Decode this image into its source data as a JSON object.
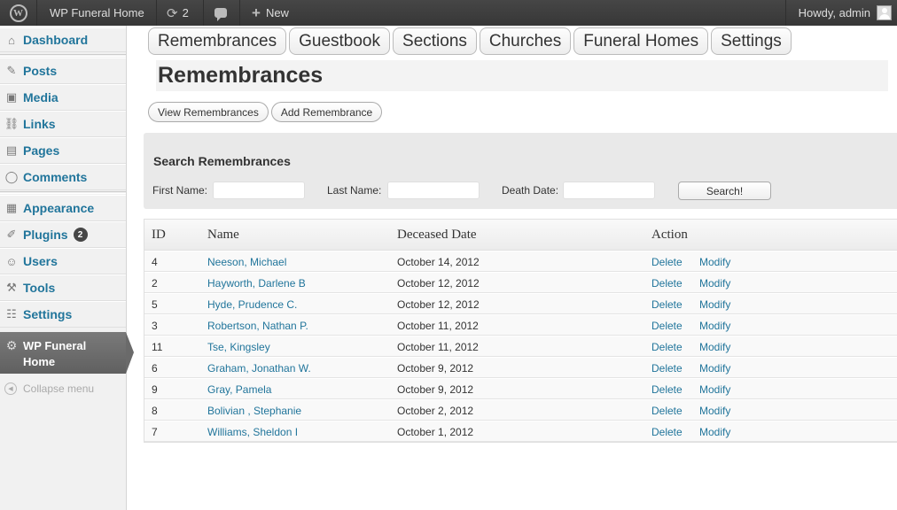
{
  "adminbar": {
    "logo": "W",
    "site_name": "WP Funeral Home",
    "updates_count": "2",
    "new_label": "New",
    "howdy": "Howdy, admin",
    "icons": [
      "wordpress-logo-icon",
      "updates-icon",
      "comments-icon",
      "plus-icon",
      "avatar-icon"
    ]
  },
  "sidebar": {
    "items": [
      {
        "label": "Dashboard",
        "icon": "home-icon",
        "glyph": "⌂"
      },
      {
        "label": "Posts",
        "icon": "pin-icon",
        "glyph": "✎"
      },
      {
        "label": "Media",
        "icon": "media-icon",
        "glyph": "▣"
      },
      {
        "label": "Links",
        "icon": "link-icon",
        "glyph": "⛓"
      },
      {
        "label": "Pages",
        "icon": "pages-icon",
        "glyph": "▤"
      },
      {
        "label": "Comments",
        "icon": "comment-icon",
        "glyph": "◯"
      },
      {
        "label": "Appearance",
        "icon": "appearance-icon",
        "glyph": "▦"
      },
      {
        "label": "Plugins",
        "icon": "plugin-icon",
        "glyph": "✐",
        "badge": "2"
      },
      {
        "label": "Users",
        "icon": "users-icon",
        "glyph": "☺"
      },
      {
        "label": "Tools",
        "icon": "tools-icon",
        "glyph": "⚒"
      },
      {
        "label": "Settings",
        "icon": "settings-icon",
        "glyph": "☷"
      }
    ],
    "current": "WP Funeral Home",
    "collapse": "Collapse menu"
  },
  "tabs": [
    "Remembrances",
    "Guestbook",
    "Sections",
    "Churches",
    "Funeral Homes",
    "Settings"
  ],
  "page_title": "Remembrances",
  "sub_buttons": [
    "View Remembrances",
    "Add Remembrance"
  ],
  "search": {
    "title": "Search Remembrances",
    "first_name_label": "First Name:",
    "last_name_label": "Last Name:",
    "death_date_label": "Death Date:",
    "first_name_value": "",
    "last_name_value": "",
    "death_date_value": "",
    "button": "Search!"
  },
  "table": {
    "headers": {
      "id": "ID",
      "name": "Name",
      "date": "Deceased Date",
      "action": "Action"
    },
    "rows": [
      {
        "id": "4",
        "name": "Neeson, Michael",
        "date": "October 14, 2012"
      },
      {
        "id": "2",
        "name": "Hayworth, Darlene B",
        "date": "October 12, 2012"
      },
      {
        "id": "5",
        "name": "Hyde, Prudence C.",
        "date": "October 12, 2012"
      },
      {
        "id": "3",
        "name": "Robertson, Nathan P.",
        "date": "October 11, 2012"
      },
      {
        "id": "11",
        "name": "Tse, Kingsley",
        "date": "October 11, 2012"
      },
      {
        "id": "6",
        "name": "Graham, Jonathan W.",
        "date": "October 9, 2012"
      },
      {
        "id": "9",
        "name": "Gray, Pamela",
        "date": "October 9, 2012"
      },
      {
        "id": "8",
        "name": "Bolivian , Stephanie",
        "date": "October 2, 2012"
      },
      {
        "id": "7",
        "name": "Williams, Sheldon I",
        "date": "October 1, 2012"
      }
    ],
    "delete_label": "Delete",
    "modify_label": "Modify"
  },
  "colors": {
    "link": "#21759b",
    "adminbar": "#464646",
    "sidebar_current": "#6d6d6d"
  }
}
